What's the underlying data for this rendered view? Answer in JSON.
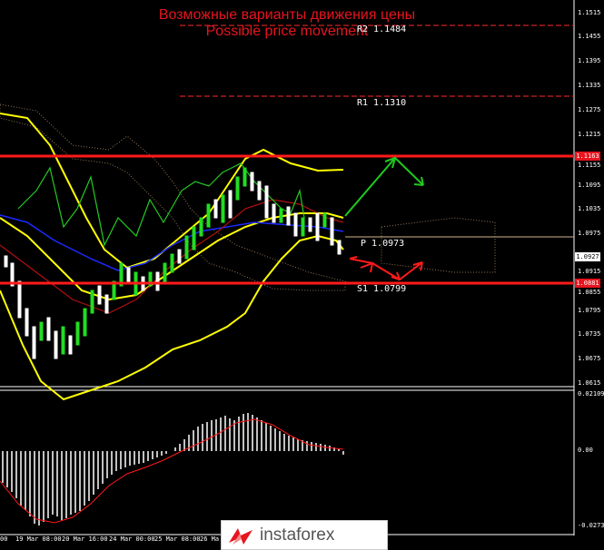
{
  "titles": {
    "ru": "Возможные варианты движения цены",
    "en": "Possible price movement"
  },
  "levels": {
    "r2": "R2 1.1484",
    "r1": "R1 1.1310",
    "p": "P 1.0973",
    "s1": "S1 1.0799"
  },
  "price_tags": {
    "upper_red": "1.1163",
    "current": "1.0927",
    "lower_red": "1.0881"
  },
  "y_axis_labels": [
    "1.1515",
    "1.1455",
    "1.1395",
    "1.1335",
    "1.1275",
    "1.1215",
    "1.1155",
    "1.1095",
    "1.1035",
    "1.0975",
    "1.0915",
    "1.0855",
    "1.0795",
    "1.0735",
    "1.0675",
    "1.0615"
  ],
  "macd_labels": [
    "0.02109",
    "0.00",
    "-0.02739"
  ],
  "x_axis_labels": [
    "00",
    "19 Mar 08:00",
    "20 Mar 16:00",
    "24 Mar 00:00",
    "25 Mar 08:00",
    "26 Ma"
  ],
  "colors": {
    "red": "#ff1a1a",
    "bollinger": "#ffff00",
    "green_arrow": "#1ec81e",
    "red_arrow": "#ff1a1a",
    "bull_candle": "#22dd22",
    "macd_hist": "#c0c0c0",
    "signal": "#ff1a1a"
  },
  "logo": {
    "text": "instaforex"
  }
}
